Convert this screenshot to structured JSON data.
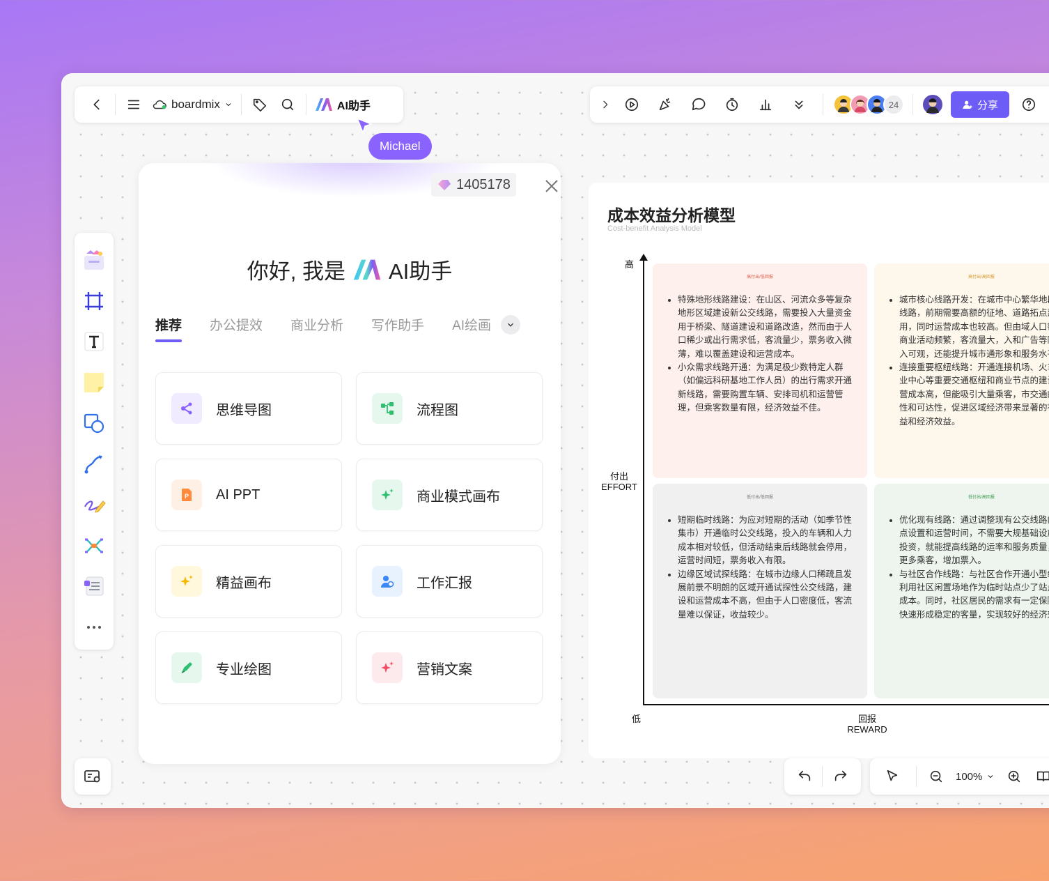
{
  "toolbar_left": {
    "brand": "boardmix",
    "ai_label": "AI助手"
  },
  "collaborator_cursor": {
    "name": "Michael"
  },
  "toolbar_right": {
    "avatar_count": "24",
    "share_label": "分享"
  },
  "ai_panel": {
    "credits": "1405178",
    "greeting_prefix": "你好, 我是",
    "greeting_name": "AI助手",
    "tabs": [
      "推荐",
      "办公提效",
      "商业分析",
      "写作助手",
      "AI绘画"
    ],
    "cards": [
      {
        "label": "思维导图",
        "icon": "mindmap-icon"
      },
      {
        "label": "流程图",
        "icon": "flowchart-icon"
      },
      {
        "label": "AI PPT",
        "icon": "ppt-icon"
      },
      {
        "label": "商业模式画布",
        "icon": "sparkle-icon"
      },
      {
        "label": "精益画布",
        "icon": "sparkle-icon"
      },
      {
        "label": "工作汇报",
        "icon": "person-report-icon"
      },
      {
        "label": "专业绘图",
        "icon": "drawing-icon"
      },
      {
        "label": "营销文案",
        "icon": "sparkle-icon"
      }
    ]
  },
  "board": {
    "title": "成本效益分析模型",
    "subtitle": "Cost-benefit Analysis Model",
    "y_high": "高",
    "y_label_cn": "付出",
    "y_label_en": "EFFORT",
    "x_low": "低",
    "x_label_cn": "回报",
    "x_label_en": "REWARD",
    "quadrants": {
      "top_left": {
        "tag": "高付出/低回报",
        "items": [
          "特殊地形线路建设：在山区、河流众多等复杂地形区域建设新公交线路，需要投入大量资金用于桥梁、隧道建设和道路改造，然而由于人口稀少或出行需求低，客流量少，票务收入微薄，难以覆盖建设和运营成本。",
          "小众需求线路开通：为满足极少数特定人群（如偏远科研基地工作人员）的出行需求开通新线路，需要购置车辆、安排司机和运营管理，但乘客数量有限，经济效益不佳。"
        ]
      },
      "top_right": {
        "tag": "高付出/高回报",
        "items": [
          "城市核心线路开发：在城市中心繁华地段公交线路，前期需要高额的征地、道路拓点建设费用，同时运营成本也较高。但由域人口密集、商业活动频繁，客流量大，入和广告等附加收入可观，还能提升城市通形象和服务水平。",
          "连接重要枢纽线路：开通连接机场、火车型商业中心等重要交通枢纽和商业节点的建设和运营成本高，但能吸引大量乘客，市交通的便利性和可达性，促进区域经济带来显著的社会效益和经济效益。"
        ]
      },
      "bottom_left": {
        "tag": "低付出/低回报",
        "items": [
          "短期临时线路：为应对短期的活动（如季节性集市）开通临时公交线路，投入的车辆和人力成本相对较低，但活动结束后线路就会停用，运营时间短，票务收入有限。",
          "边缘区域试探线路：在城市边缘人口稀疏且发展前景不明朗的区域开通试探性公交线路，建设和运营成本不高，但由于人口密度低，客流量难以保证，收益较少。"
        ]
      },
      "bottom_right": {
        "tag": "低付出/高回报",
        "items": [
          "优化现有线路：通过调整现有公交线路向、站点设置和运营时间，不需要大规基础设施建设投资，就能提高线路的运率和服务质量，吸引更多乘客，增加票入。",
          "与社区合作线路：与社区合作开通小型线路，利用社区闲置场地作为临时站点少了站点建设成本。同时，社区居民的需求有一定保障，能快速形成稳定的客量，实现较好的经济效益。"
        ]
      }
    }
  },
  "zoom": {
    "value": "100%"
  },
  "colors": {
    "accent": "#6d5cf6",
    "q_top_left": "#fdf0ed",
    "q_top_right": "#fdf7ec",
    "q_bottom_left": "#f0f0f1",
    "q_bottom_right": "#eef5ee"
  }
}
